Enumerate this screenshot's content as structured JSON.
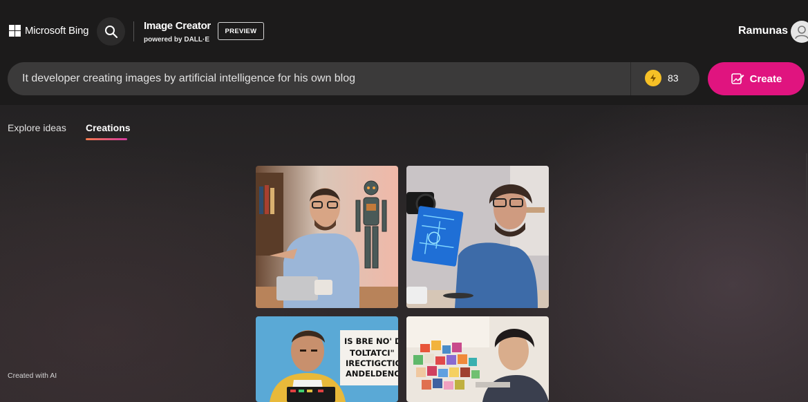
{
  "header": {
    "brand": "Microsoft Bing",
    "product_title": "Image Creator",
    "powered_by": "powered by DALL·E",
    "badge": "PREVIEW",
    "user_name": "Ramunas"
  },
  "prompt": {
    "value": "It developer creating images by artificial intelligence for his own blog",
    "boosts_remaining": "83",
    "create_label": "Create"
  },
  "tabs": [
    {
      "label": "Explore ideas",
      "active": false
    },
    {
      "label": "Creations",
      "active": true
    }
  ],
  "gallery": {
    "sign_lines": [
      "IS BRE NO' DRDE",
      "TOLTATCI\"",
      "IRECTIGCTIOND AN",
      "ANDELDENOTIF"
    ]
  },
  "footer": {
    "note": "Created with AI"
  },
  "colors": {
    "accent": "#e0147f",
    "boost_coin": "#f6c026",
    "header_bg": "#1c1b1b"
  },
  "icons": {
    "brand": "microsoft-logo-icon",
    "search": "search-icon",
    "boost": "lightning-icon",
    "create": "create-image-icon",
    "avatar": "user-avatar-icon"
  }
}
